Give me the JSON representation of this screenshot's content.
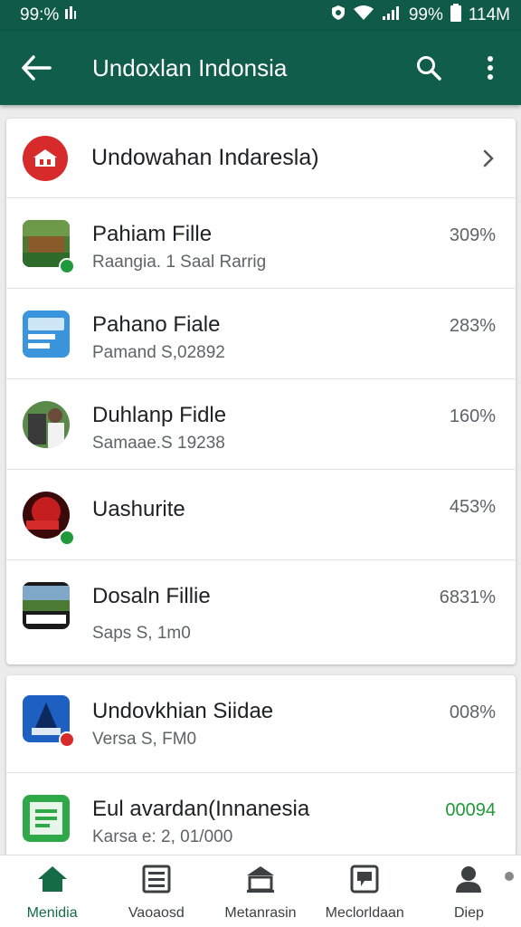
{
  "status_bar": {
    "time": "99:%",
    "battery": "99%",
    "speed": "114M"
  },
  "app_bar": {
    "title": "Undoxlan Indonsia",
    "back_icon": "arrow-back-icon",
    "search_icon": "search-icon",
    "menu_icon": "more-vert-icon"
  },
  "header": {
    "title": "Undowahan Indaresla)"
  },
  "items": [
    {
      "name": "Pahiam Fille",
      "sub": "Raangia. 1 Saal Rarrig",
      "percent": "309%"
    },
    {
      "name": "Pahano Fiale",
      "sub": "Pamand S,02892",
      "percent": "283%"
    },
    {
      "name": "Duhlanp Fidle",
      "sub": "Samaae.S 19238",
      "percent": "160%"
    },
    {
      "name": "Uashurite",
      "sub": "",
      "percent": "453%"
    },
    {
      "name": "Dosaln Fillie",
      "sub": "Saps S, 1m0",
      "percent": "6831%"
    }
  ],
  "items2": [
    {
      "name": "Undovkhian Siidae",
      "sub": "Versa S, FM0",
      "percent": "008%"
    },
    {
      "name": "Eul avardan(Innanesia",
      "sub": "Karsa e: 2, 01/000",
      "percent": "00094"
    }
  ],
  "bottom_nav": [
    {
      "label": "Menidia",
      "icon": "home-icon"
    },
    {
      "label": "Vaoaosd",
      "icon": "list-icon"
    },
    {
      "label": "Metanrasin",
      "icon": "bank-icon"
    },
    {
      "label": "Meclorldaan",
      "icon": "image-icon"
    },
    {
      "label": "Diep",
      "icon": "person-icon"
    }
  ],
  "colors": {
    "primary": "#115d4b",
    "status": "#0f5a48",
    "accent_green": "#1e9a3a",
    "logo_red": "#d72a2a"
  }
}
